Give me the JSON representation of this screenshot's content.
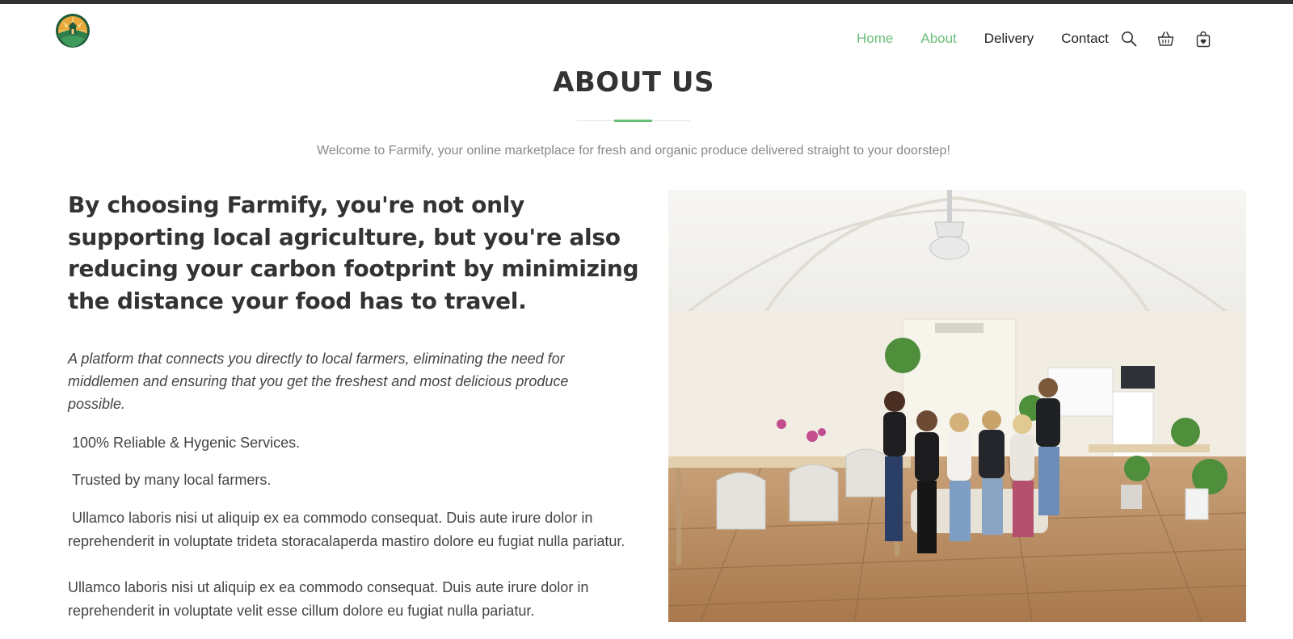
{
  "brand": {
    "logo_icon": "farm-sun-logo-icon",
    "colors": {
      "accent": "#6abf7a",
      "heading": "#333333",
      "text": "#444444",
      "muted": "#888888"
    }
  },
  "nav": {
    "items": [
      {
        "label": "Home",
        "active": true
      },
      {
        "label": "About",
        "active": true
      },
      {
        "label": "Delivery",
        "active": false
      },
      {
        "label": "Contact",
        "active": false
      }
    ],
    "icons": [
      "search-icon",
      "basket-icon",
      "shopping-bag-icon"
    ]
  },
  "page": {
    "title": "ABOUT US",
    "intro": "Welcome to Farmify, your online marketplace for fresh and organic produce delivered straight to your doorstep!"
  },
  "about": {
    "headline": "By choosing Farmify, you're not only supporting local agriculture, but you're also reducing your carbon footprint by minimizing the distance your food has to travel.",
    "lead": "A platform that connects you directly to local farmers, eliminating the need for middlemen and ensuring that you get the freshest and most delicious produce possible.",
    "features": [
      "100% Reliable & Hygenic Services.",
      "Trusted by many local farmers."
    ],
    "paragraphs": [
      "Ullamco laboris nisi ut aliquip ex ea commodo consequat. Duis aute irure dolor in reprehenderit in voluptate trideta storacalaperda mastiro dolore eu fugiat nulla pariatur.",
      "Ullamco laboris nisi ut aliquip ex ea commodo consequat. Duis aute irure dolor in reprehenderit in voluptate velit esse cillum dolore eu fugiat nulla pariatur."
    ]
  }
}
